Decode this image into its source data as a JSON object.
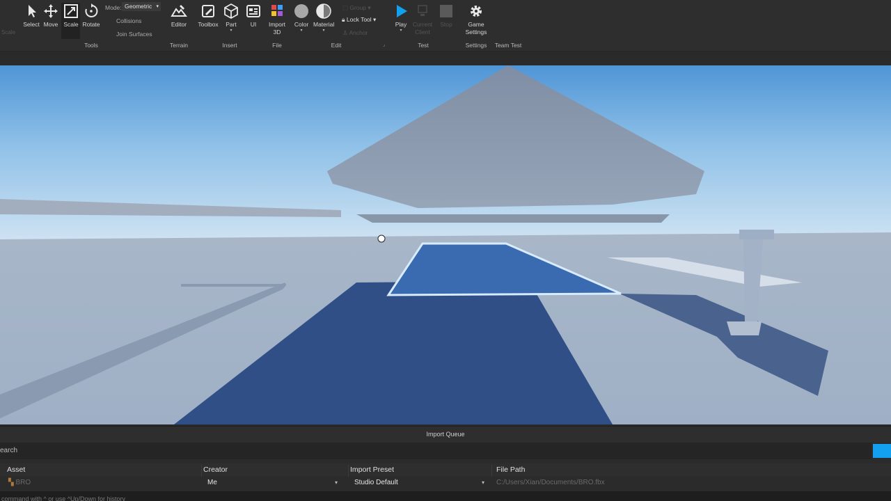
{
  "ribbon": {
    "tools": {
      "select": "Select",
      "move": "Move",
      "scale": "Scale",
      "rotate": "Rotate",
      "mode_label": "Mode:",
      "mode_value": "Geometric",
      "collisions": "Collisions",
      "join_surfaces": "Join Surfaces",
      "group_label": "Tools"
    },
    "terrain": {
      "editor": "Editor",
      "group_label": "Terrain"
    },
    "insert": {
      "toolbox": "Toolbox",
      "part": "Part",
      "ui": "UI",
      "group_label": "Insert"
    },
    "file": {
      "import_3d": "Import\n3D",
      "group_label": "File"
    },
    "edit": {
      "color": "Color",
      "material": "Material",
      "group": "Group",
      "lock_tool": "Lock Tool",
      "anchor": "Anchor",
      "group_label": "Edit"
    },
    "test": {
      "play": "Play",
      "current_client": "Current\nClient",
      "stop": "Stop",
      "group_label": "Test"
    },
    "settings": {
      "game_settings": "Game\nSettings",
      "group_label": "Settings"
    },
    "team_test": {
      "group_label": "Team Test"
    },
    "icon_names": [
      "select-arrow-icon",
      "move-arrows-icon",
      "scale-icon",
      "rotate-icon",
      "terrain-editor-icon",
      "toolbox-icon",
      "part-cube-icon",
      "ui-icon",
      "import-3d-icon",
      "color-circle-icon",
      "material-sphere-icon",
      "lock-icon",
      "play-icon",
      "stop-icon",
      "gear-icon"
    ],
    "accent_color": "#12a0ef"
  },
  "import_queue": {
    "title": "Import Queue",
    "search_placeholder": "earch",
    "columns": [
      "Asset",
      "Creator",
      "Import Preset",
      "File Path"
    ],
    "row": {
      "asset": "BRO",
      "creator": "Me",
      "preset": "Studio Default",
      "file_path": "C:/Users/Xian/Documents/BRO.fbx"
    }
  },
  "command_bar": {
    "hint": "command with ^ or use ^Up/Down for history"
  }
}
